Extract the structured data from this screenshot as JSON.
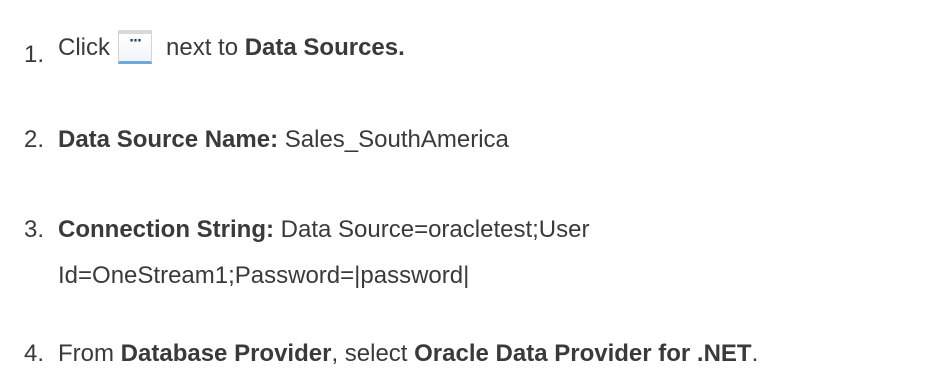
{
  "steps": [
    {
      "number": "1.",
      "click": "Click",
      "icon": "ellipsis-button-icon",
      "icon_glyph": "···",
      "next_to": "next to",
      "target": "Data Sources."
    },
    {
      "number": "2.",
      "label": "Data Source Name:",
      "value": "Sales_SouthAmerica"
    },
    {
      "number": "3.",
      "label": "Connection String:",
      "value_line1": "Data Source=oracletest;User",
      "value_line2": "Id=OneStream1;Password=|password|"
    },
    {
      "number": "4.",
      "from": "From",
      "source": "Database Provider",
      "comma_select": ", select",
      "provider": "Oracle Data Provider for .NET",
      "period": "."
    }
  ]
}
